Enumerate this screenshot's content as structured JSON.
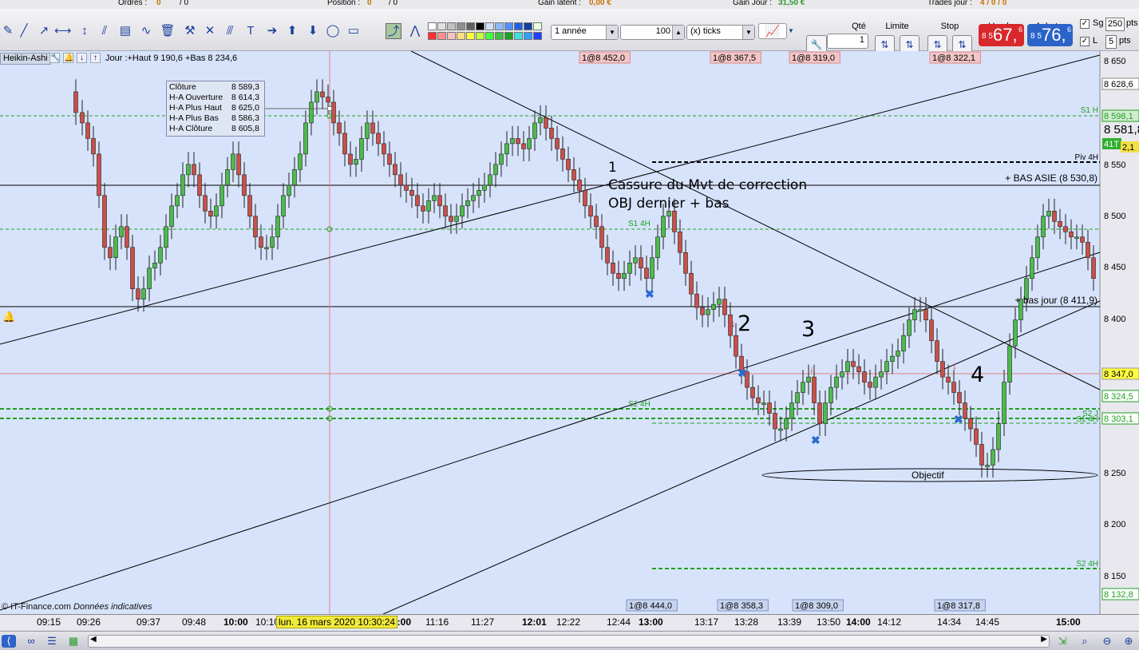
{
  "status": {
    "orders_label": "Ordres :",
    "orders_val": "0",
    "orders_sep": "/ 0",
    "position_label": "Position :",
    "position_val": "0",
    "position_sep": "/ 0",
    "gain_latent_label": "Gain latent :",
    "gain_latent_val": "0,00 €",
    "gain_jour_label": "Gain Jour :",
    "gain_jour_val": "31,50 €",
    "trades_label": "Trades jour :",
    "trades_val": "4 / 0 / 0"
  },
  "toolbar": {
    "period_select": "1 année",
    "count_value": "100",
    "unit_select": "(x) ticks",
    "icon_names": [
      "pencil-icon",
      "line-icon",
      "ray-icon",
      "horizontal-line-icon",
      "vertical-line-icon",
      "channel-icon",
      "fibonacci-icon",
      "wave-icon",
      "trash-icon",
      "tools-icon",
      "cross-line-icon",
      "parallel-icon",
      "text-icon",
      "arrow-right-icon",
      "arrow-up-icon",
      "arrow-down-icon",
      "ellipse-icon",
      "rectangle-icon",
      "trend-icon",
      "fan-icon"
    ],
    "swatch_colors": [
      "#ffffff",
      "#e0e0e0",
      "#c0c0c0",
      "#909090",
      "#606060",
      "#000000",
      "#d0e0ff",
      "#90b8ff",
      "#5090ff",
      "#2060e0",
      "#1040a0",
      "#e8ffe0",
      "#ff3030",
      "#ff9090",
      "#ffc0c0",
      "#ffe080",
      "#ffff40",
      "#c0ff40",
      "#40ff40",
      "#40c040",
      "#20a020",
      "#40e0e0",
      "#30a0ff",
      "#2040ff"
    ]
  },
  "order_panel": {
    "qte_label": "Qté",
    "qte_value": "1",
    "limite_label": "Limite",
    "stop_label": "Stop",
    "vendre_label": "Vendre",
    "acheter_label": "Acheter",
    "sell_prefix": "8 5",
    "sell_price": "67,",
    "sell_sup": "6",
    "buy_prefix": "8 5",
    "buy_price": "76,",
    "buy_sup": "6",
    "sg_label": "Sg",
    "sg_value": "250",
    "pts_label": "pts",
    "l_label": "L",
    "l_value": "5",
    "pts_label2": "pts"
  },
  "chart": {
    "type_label": "Heikin-Ashi",
    "header": "Jour :+Haut 9 190,6 +Bas 8 234,6",
    "ohlc": [
      {
        "k": "Clôture",
        "v": "8 589,3"
      },
      {
        "k": "H-A Ouverture",
        "v": "8 614,3"
      },
      {
        "k": "H-A Plus Haut",
        "v": "8 625,0"
      },
      {
        "k": "H-A Plus Bas",
        "v": "8 586,3"
      },
      {
        "k": "H-A Clôture",
        "v": "8 605,8"
      }
    ],
    "top_tags": [
      "1@8 452,0",
      "1@8 367,5",
      "1@8 319,0",
      "1@8 322,1"
    ],
    "bottom_tags": [
      "1@8 444,0",
      "1@8 358,3",
      "1@8 309,0",
      "1@8 317,8"
    ],
    "annotation_1": "1",
    "annotation_text_1": "Cassure du Mvt de correction",
    "annotation_text_2": "OBJ dernier + bas",
    "annotation_2": "2",
    "annotation_3": "3",
    "annotation_4": "4",
    "objectif": "Objectif",
    "bas_asie": "+ BAS ASIE (8 530,8)",
    "bas_jour": "+ bas jour (8 411,9)",
    "level_labels": {
      "s1h": "S1 H",
      "piv4h": "Piv 4H",
      "s1_4h": "S1 4H",
      "s2_4h": "S2 4H",
      "s2j": "S2 J",
      "s1_4h_right": "S1 4H",
      "s2_4h_bottom": "S2 4H"
    },
    "copyright": "© IT-Finance.com",
    "copyright_note": "Données indicatives"
  },
  "price_axis": {
    "ticks": [
      "8 650",
      "8 628,6",
      "8 598,1",
      "8 581,8",
      "8 550",
      "8 500",
      "8 450",
      "8 400",
      "8 347,0",
      "8 324,5",
      "8 303,1",
      "8 250",
      "8 200",
      "8 150",
      "8 132,8"
    ],
    "extra_tags": [
      "41T",
      "2,1"
    ]
  },
  "time_axis": {
    "labels": [
      "09:15",
      "09:26",
      "09:37",
      "09:48",
      "10:00",
      "10:10",
      "11:00",
      "11:16",
      "11:27",
      "12:01",
      "12:22",
      "12:44",
      "13:00",
      "13:17",
      "13:28",
      "13:39",
      "13:50",
      "14:00",
      "14:12",
      "14:34",
      "14:45",
      "15:00"
    ],
    "cursor_label": "lun. 16 mars 2020 10:30:24"
  },
  "colors": {
    "chart_bg": "#d7e3fb",
    "bull": "#4cbb4c",
    "bear": "#c9504a",
    "level_green": "#20a020",
    "cursor_line": "#e08080"
  }
}
